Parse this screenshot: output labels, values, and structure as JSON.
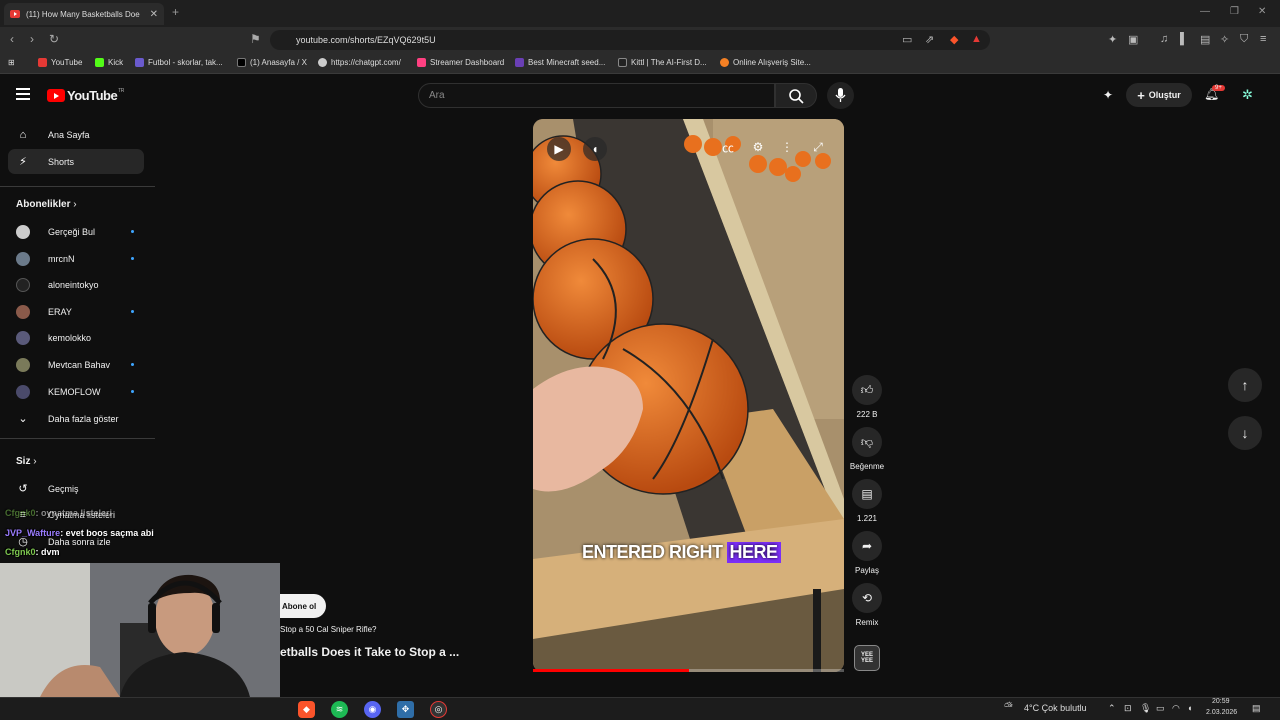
{
  "browser": {
    "tab_title": "(11) How Many Basketballs Doe",
    "url": "youtube.com/shorts/EZqVQ629t5U",
    "bookmarks": [
      "YouTube",
      "Kick",
      "Futbol - skorlar, tak...",
      "(1) Anasayfa / X",
      "https://chatgpt.com/",
      "Streamer Dashboard",
      "Best Minecraft seed...",
      "Kittl | The AI-First D...",
      "Online Alışveriş Site..."
    ]
  },
  "header": {
    "logo_text": "YouTube",
    "region": "TR",
    "search_placeholder": "Ara",
    "create_label": "Oluştur",
    "notif_count": "9+"
  },
  "sidebar": {
    "home": "Ana Sayfa",
    "shorts": "Shorts",
    "subs_title": "Abonelikler",
    "subscriptions": [
      {
        "name": "Gerçeği Bul",
        "new": true
      },
      {
        "name": "mrcnN",
        "new": true
      },
      {
        "name": "aloneintokyo",
        "new": false
      },
      {
        "name": "ERAY",
        "new": true
      },
      {
        "name": "kemolokko",
        "new": false
      },
      {
        "name": "Mevtcan Bahav",
        "new": true
      },
      {
        "name": "KEMOFLOW",
        "new": true
      }
    ],
    "show_more": "Daha fazla göster",
    "you_title": "Siz",
    "history": "Geçmiş",
    "playlists": "Oynatma listeleri",
    "watch_later": "Daha sonra izle"
  },
  "chat": [
    {
      "user": "Cfgnk0",
      "msg": ": oynatma listeleri",
      "color": "#7ec850"
    },
    {
      "user": "JVP_Wafture",
      "msg": ": evet boos saçma abi",
      "color": "#9a7cff"
    },
    {
      "user": "Cfgnk0",
      "msg": ": dvm",
      "color": "#7ec850"
    }
  ],
  "short": {
    "caption_white": "ENTERED RIGHT",
    "caption_highlight": "HERE",
    "subscribe": "Abone ol",
    "subtitle": "Stop a 50 Cal Sniper Rifle?",
    "title": "etballs Does it Take to Stop a ...",
    "progress": 0.5
  },
  "actions": {
    "likes": "222 B",
    "dislike": "Beğenme",
    "comments": "1.221",
    "share": "Paylaş",
    "remix": "Remix",
    "channel_badge": "YEE YEE"
  },
  "taskbar": {
    "weather": "4°C  Çok bulutlu",
    "time": "20:59",
    "date": "2.03.2026"
  },
  "colors": {
    "accent": "#ff0000",
    "caption_highlight": "#7b2ff7",
    "new_dot": "#3ea6ff"
  }
}
